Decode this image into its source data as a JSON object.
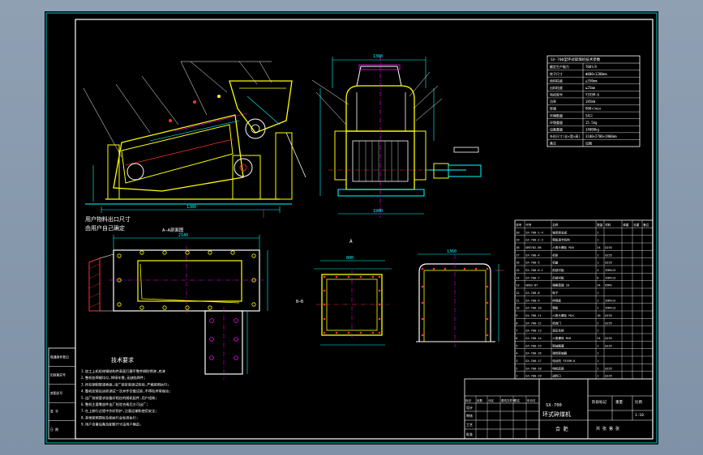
{
  "colors": {
    "border": "#00c8c8",
    "frame": "#ffffff",
    "yellow": "#ffff00",
    "magenta": "#ff00ff",
    "red": "#ff3030",
    "cyan": "#00ffff",
    "green": "#00ff00",
    "blue": "#2d5bff",
    "white": "#ffffff",
    "background": "#000000"
  },
  "labels": {
    "outlet_note_1": "用户物料出口尺寸",
    "outlet_note_2": "由用户自己确定",
    "section_aa": "A—A剖面图",
    "section_a": "A",
    "section_b_left": "B",
    "section_b_right": "B",
    "bb_mark": "B—B",
    "tech_title": "技术要求",
    "dim_main_plan": "2140",
    "dim_main_elev": "1380",
    "dim_side_top": "1380",
    "dim_side_bottom": "1900",
    "dim_side_left": "2100",
    "dim_small_box": "800",
    "dim_right_box": "1360"
  },
  "tech_requirements": [
    "1.加工上机检修钢结构件表面打磨平整并刷防锈漆,底漆",
    "2.整机各焊缝均匀,焊接牢靠,无缺陷焊件;",
    "3.所有钢制管道表面,出厂前安装调试检验,严格按照执行;",
    "4.整机安装后运转调试一次并作空载试验,不得有异常振动;",
    "5.出厂前按要求准备好相应的随机配件,用户组装;",
    "6.整机主要零部件出厂检验合格后方可出厂;",
    "7.在上装行过程中作好防护,注意运输和使用安全;",
    "8.其他按照国标及相关行业标准执行;",
    "9.用户自备设备及配套尺寸由用户确定。"
  ],
  "spec_table": {
    "title": "SX-700型环式碎煤机技术参数",
    "rows": [
      [
        "额定生产能力",
        "700t/h"
      ],
      [
        "转子尺寸",
        "Φ800×1200mm"
      ],
      [
        "给料粒度",
        "≤350mm"
      ],
      [
        "出料粒度",
        "≤25mm"
      ],
      [
        "电机型号",
        "Y355M-6"
      ],
      [
        "功率",
        "185kW"
      ],
      [
        "转速",
        "980r/min"
      ],
      [
        "环锤数量",
        "54只"
      ],
      [
        "环锤重量",
        "15.5kg"
      ],
      [
        "设备重量",
        "14000kg"
      ],
      [
        "外形尺寸(长×宽×高)",
        "3100×2780×1900mm"
      ],
      [
        "备注",
        "见图"
      ]
    ]
  },
  "parts_table": {
    "header": [
      "序号",
      "代号",
      "名称",
      "数量",
      "材料",
      "单重",
      "总重",
      "备注"
    ],
    "rows": [
      [
        "20",
        "SX-700-1-4",
        "轴承座总成",
        "2",
        "",
        "",
        "",
        ""
      ],
      [
        "19",
        "SX-700-2-3",
        "筛板调节机构",
        "1",
        "",
        "",
        "",
        ""
      ],
      [
        "18",
        "GB5782-86",
        "六角头螺栓 M20",
        "24",
        "Q235",
        "",
        "",
        ""
      ],
      [
        "17",
        "SX-700-4",
        "机体",
        "1",
        "Q235",
        "",
        "",
        ""
      ],
      [
        "16",
        "SX-700-5",
        "机盖",
        "1",
        "Q235",
        "",
        "",
        ""
      ],
      [
        "15",
        "SX-700-6-1",
        "前部衬板",
        "4",
        "ZGMn13",
        "",
        "",
        ""
      ],
      [
        "14",
        "SX-700-7",
        "后部衬板",
        "6",
        "ZGMn13",
        "",
        "",
        ""
      ],
      [
        "13",
        "GB93-87",
        "弹簧垫圈 20",
        "24",
        "65Mn",
        "",
        "",
        ""
      ],
      [
        "12",
        "SX-700-8",
        "转子",
        "1",
        "",
        "",
        "",
        ""
      ],
      [
        "11",
        "SX-700-9",
        "碎煤板",
        "1",
        "ZGMn13",
        "",
        "",
        ""
      ],
      [
        "10",
        "SX-700-10",
        "筛板",
        "2",
        "ZGMn13",
        "",
        "",
        ""
      ],
      [
        "9",
        "SX-700-11",
        "六角头螺栓 M24",
        "16",
        "Q235",
        "",
        "",
        ""
      ],
      [
        "8",
        "SX-700-12",
        "检查门",
        "2",
        "Q235",
        "",
        "",
        ""
      ],
      [
        "7",
        "SX-700-13",
        "液压系统",
        "1",
        "",
        "",
        "",
        ""
      ],
      [
        "6",
        "SX-700-14",
        "六角螺母 M20",
        "24",
        "Q235",
        "",
        "",
        ""
      ],
      [
        "5",
        "SX-700-15",
        "联轴器罩",
        "1",
        "Q235",
        "",
        "",
        ""
      ],
      [
        "4",
        "SX-700-16",
        "弹性联轴器",
        "1",
        "",
        "",
        "",
        ""
      ],
      [
        "3",
        "SX-700-17",
        "电动机 Y355M-6",
        "1",
        "",
        "",
        "",
        ""
      ],
      [
        "2",
        "SX-700-18",
        "电机底座",
        "1",
        "Q235",
        "",
        "",
        ""
      ],
      [
        "1",
        "SX-700-19",
        "进料口",
        "1",
        "Q235",
        "",
        "",
        ""
      ]
    ]
  },
  "title_block": {
    "drawing_no": "SX-700",
    "name": "环式碎煤机",
    "scale_label": "比例",
    "scale": "1:10",
    "sheet_label": "共 张 第 张",
    "weight_label": "重量",
    "company": "合 肥",
    "row_labels": [
      "标记",
      "处数",
      "分区",
      "更改文件号",
      "签名",
      "年月日"
    ],
    "roles": [
      "设计",
      "审核",
      "工艺",
      "批准"
    ],
    "stage": "阶段标记"
  },
  "left_strip": [
    "借通用件登记",
    "旧底图总号",
    "底图总号",
    "签 字",
    "日 期"
  ]
}
